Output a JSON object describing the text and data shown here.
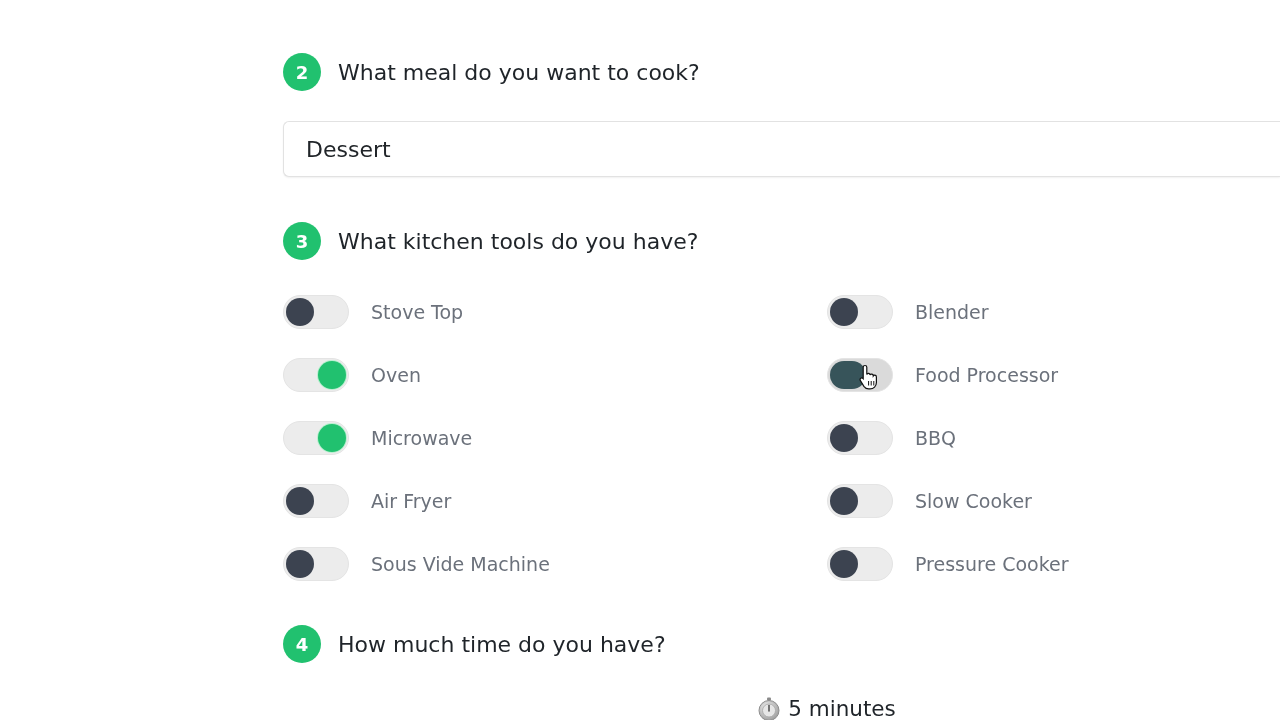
{
  "steps": [
    {
      "number": "2",
      "question": "What meal do you want to cook?",
      "kind": "text",
      "value": "Dessert"
    },
    {
      "number": "3",
      "question": "What kitchen tools do you have?",
      "kind": "toggles",
      "options": [
        {
          "label": "Stove Top",
          "on": false,
          "hovered": false
        },
        {
          "label": "Oven",
          "on": true,
          "hovered": false
        },
        {
          "label": "Microwave",
          "on": true,
          "hovered": false
        },
        {
          "label": "Air Fryer",
          "on": false,
          "hovered": false
        },
        {
          "label": "Sous Vide Machine",
          "on": false,
          "hovered": false
        },
        {
          "label": "Blender",
          "on": false,
          "hovered": false
        },
        {
          "label": "Food Processor",
          "on": false,
          "hovered": true
        },
        {
          "label": "BBQ",
          "on": false,
          "hovered": false
        },
        {
          "label": "Slow Cooker",
          "on": false,
          "hovered": false
        },
        {
          "label": "Pressure Cooker",
          "on": false,
          "hovered": false
        }
      ]
    },
    {
      "number": "4",
      "question": "How much time do you have?",
      "kind": "time",
      "reading": "5 minutes"
    }
  ]
}
